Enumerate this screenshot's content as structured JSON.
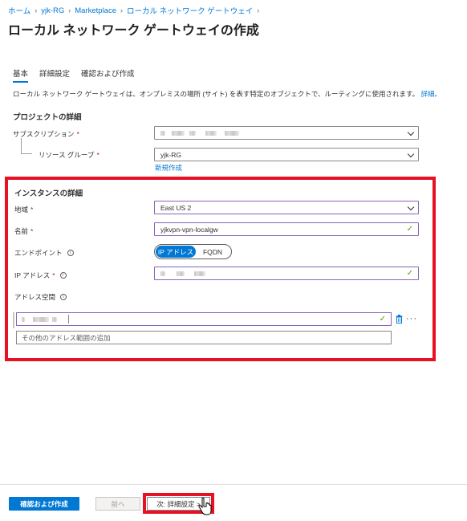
{
  "breadcrumb": [
    {
      "label": "ホーム"
    },
    {
      "label": "yjk-RG"
    },
    {
      "label": "Marketplace"
    },
    {
      "label": "ローカル ネットワーク ゲートウェイ"
    }
  ],
  "page": {
    "title": "ローカル ネットワーク ゲートウェイの作成",
    "more": "···"
  },
  "tabs": [
    {
      "label": "基本",
      "active": true
    },
    {
      "label": "詳細設定",
      "active": false
    },
    {
      "label": "確認および作成",
      "active": false
    }
  ],
  "description": {
    "text": "ローカル ネットワーク ゲートウェイは、オンプレミスの場所 (サイト) を表す特定のオブジェクトで、ルーティングに使用されます。",
    "link": "詳細。"
  },
  "project": {
    "title": "プロジェクトの詳細",
    "subscription_label": "サブスクリプション",
    "resource_group_label": "リソース グループ",
    "resource_group_value": "yjk-RG",
    "create_new": "新規作成",
    "required_mark": "*"
  },
  "instance": {
    "title": "インスタンスの詳細",
    "region_label": "地域",
    "region_value": "East US 2",
    "name_label": "名前",
    "name_value": "yjkvpn-vpn-localgw",
    "endpoint_label": "エンドポイント",
    "endpoint_options": [
      "IP アドレス",
      "FQDN"
    ],
    "endpoint_selected": "IP アドレス",
    "ip_label": "IP アドレス",
    "address_space_label": "アドレス空間",
    "address_placeholder": "その他のアドレス範囲の追加"
  },
  "footer": {
    "review_create": "確認および作成",
    "previous": "前へ",
    "next": "次: 詳細設定 >"
  },
  "colors": {
    "accent": "#0078d4",
    "highlight": "#e81123",
    "valid": "#57a300",
    "required": "#a4262c"
  },
  "icons": {
    "info": "info-icon",
    "chevron": "chevron-down-icon",
    "check": "check-icon",
    "trash": "trash-icon",
    "cursor": "hand-cursor-icon"
  }
}
